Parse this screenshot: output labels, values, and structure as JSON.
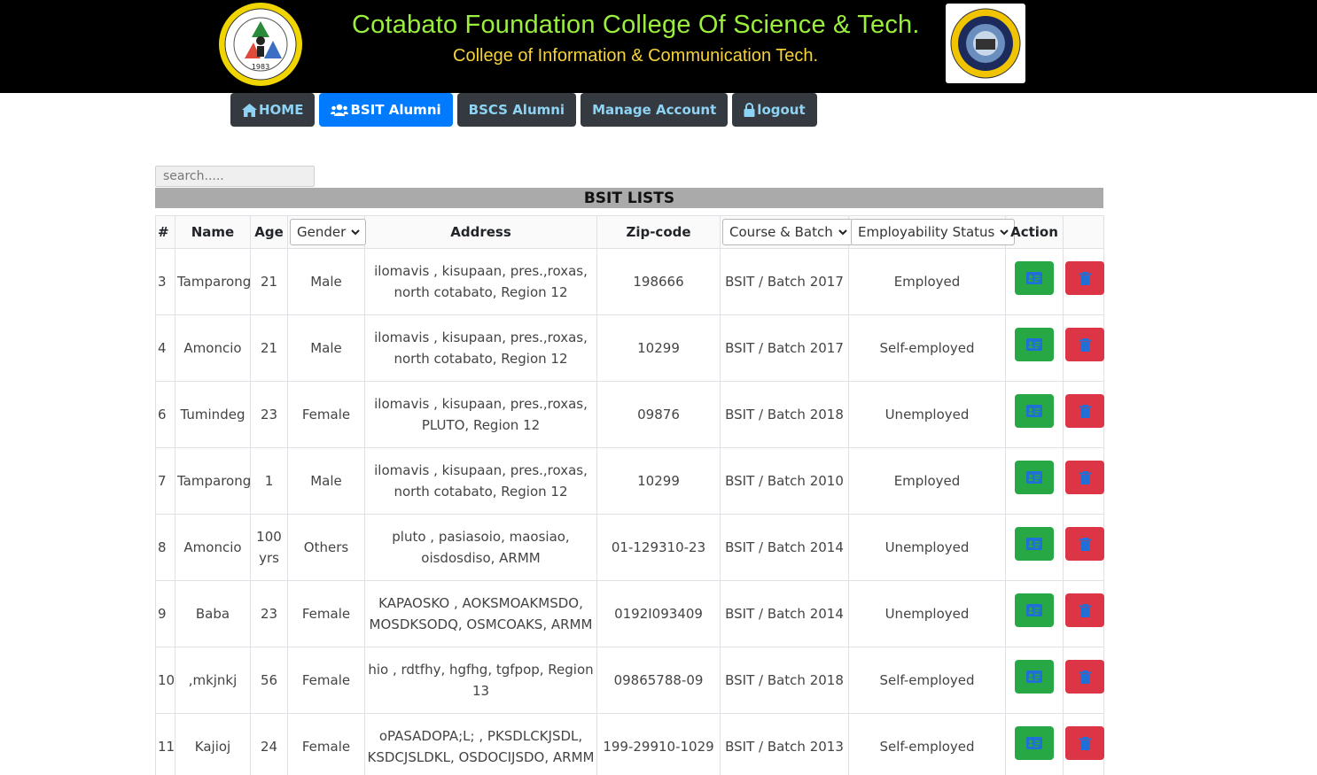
{
  "header": {
    "title": "Cotabato Foundation College Of Science & Tech.",
    "subtitle": "College of Information & Communication Tech.",
    "left_logo_year": "1983"
  },
  "nav": {
    "home": "HOME",
    "bsit": "BSIT Alumni",
    "bscs": "BSCS Alumni",
    "manage": "Manage Account",
    "logout": "logout"
  },
  "search": {
    "placeholder": "search....."
  },
  "list_title": "BSIT LISTS",
  "table": {
    "headers": {
      "num": "#",
      "name": "Name",
      "age": "Age",
      "gender": "Gender",
      "address": "Address",
      "zip": "Zip-code",
      "course": "Course & Batch",
      "status": "Employability Status",
      "action": "Action"
    },
    "rows": [
      {
        "num": "3",
        "name": "Tamparong",
        "age": "21",
        "gender": "Male",
        "address": "ilomavis , kisupaan, pres.,roxas, north cotabato, Region 12",
        "zip": "198666",
        "course": "BSIT / Batch 2017",
        "status": "Employed"
      },
      {
        "num": "4",
        "name": "Amoncio",
        "age": "21",
        "gender": "Male",
        "address": "ilomavis , kisupaan, pres.,roxas, north cotabato, Region 12",
        "zip": "10299",
        "course": "BSIT / Batch 2017",
        "status": "Self-employed"
      },
      {
        "num": "6",
        "name": "Tumindeg",
        "age": "23",
        "gender": "Female",
        "address": "ilomavis , kisupaan, pres.,roxas, PLUTO, Region 12",
        "zip": "09876",
        "course": "BSIT / Batch 2018",
        "status": "Unemployed"
      },
      {
        "num": "7",
        "name": "Tamparong",
        "age": "1",
        "gender": "Male",
        "address": "ilomavis , kisupaan, pres.,roxas, north cotabato, Region 12",
        "zip": "10299",
        "course": "BSIT / Batch 2010",
        "status": "Employed"
      },
      {
        "num": "8",
        "name": "Amoncio",
        "age": "100 yrs",
        "gender": "Others",
        "address": "pluto , pasiasoio, maosiao, oisdosdiso, ARMM",
        "zip": "01-129310-23",
        "course": "BSIT / Batch 2014",
        "status": "Unemployed"
      },
      {
        "num": "9",
        "name": "Baba",
        "age": "23",
        "gender": "Female",
        "address": "KAPAOSKO , AOKSMOAKMSDO, MOSDKSODQ, OSMCOAKS, ARMM",
        "zip": "0192I093409",
        "course": "BSIT / Batch 2014",
        "status": "Unemployed"
      },
      {
        "num": "10",
        "name": ",mkjnkj",
        "age": "56",
        "gender": "Female",
        "address": "hio , rdtfhy, hgfhg, tgfpop, Region 13",
        "zip": "09865788-09",
        "course": "BSIT / Batch 2018",
        "status": "Self-employed"
      },
      {
        "num": "11",
        "name": "Kajioj",
        "age": "24",
        "gender": "Female",
        "address": "oPASADOPA;L; , PKSDLCKJSDL, KSDCJSLDKL, OSDOCIJSDO, ARMM",
        "zip": "199-29910-1029",
        "course": "BSIT / Batch 2013",
        "status": "Self-employed"
      }
    ]
  },
  "colors": {
    "header_bg": "#000000",
    "title_green": "#9aef3c",
    "subtitle_yellow": "#f6d33a",
    "nav_dark": "#343a40",
    "nav_active": "#007bff",
    "nav_text": "#8fd3f4",
    "view_green": "#28a745",
    "delete_red": "#dc3545"
  },
  "icons": {
    "home": "home-icon",
    "bsit": "users-icon",
    "logout": "lock-icon",
    "view": "id-card-icon",
    "delete": "trash-icon",
    "dropdown": "chevron-down-icon"
  }
}
